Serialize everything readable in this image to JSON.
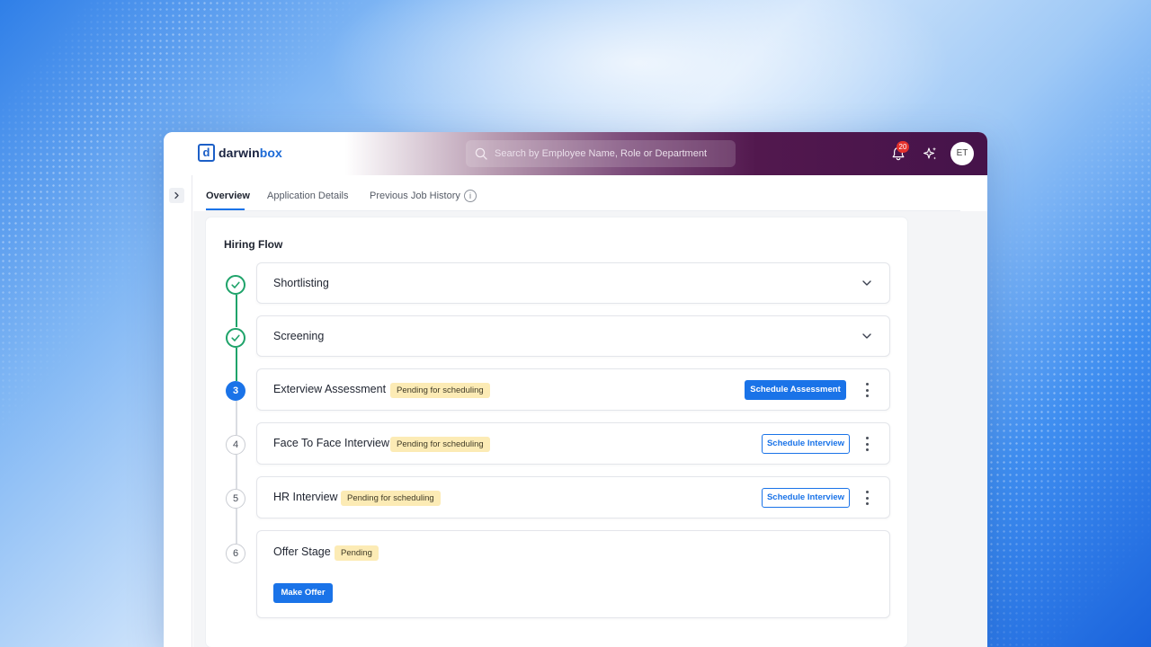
{
  "app": {
    "brand_prefix": "darwin",
    "brand_suffix": "box",
    "logo_letter": "d"
  },
  "header": {
    "search_placeholder": "Search by Employee Name, Role or Department",
    "notification_count": "20",
    "avatar_initials": "ET"
  },
  "tabs": [
    {
      "label": "Overview",
      "active": true
    },
    {
      "label": "Application Details",
      "active": false
    },
    {
      "label": "Previous Job History",
      "active": false
    }
  ],
  "hiring_flow": {
    "title": "Hiring Flow",
    "steps": [
      {
        "marker": "",
        "state": "done",
        "label": "Shortlisting"
      },
      {
        "marker": "",
        "state": "done",
        "label": "Screening"
      },
      {
        "marker": "3",
        "state": "current",
        "label": "Exterview Assessment",
        "status": "Pending for scheduling",
        "action": "Schedule Assessment"
      },
      {
        "marker": "4",
        "state": "todo",
        "label": "Face To Face Interview",
        "status": "Pending for scheduling",
        "action": "Schedule Interview"
      },
      {
        "marker": "5",
        "state": "todo",
        "label": "HR Interview",
        "status": "Pending for scheduling",
        "action": "Schedule Interview"
      },
      {
        "marker": "6",
        "state": "todo",
        "label": "Offer Stage",
        "status": "Pending",
        "action": "Make Offer"
      }
    ]
  },
  "colors": {
    "primary": "#1a73e8",
    "success": "#1fa36a",
    "pending_pill": "#fcebb5",
    "header_purple": "#45134a"
  }
}
